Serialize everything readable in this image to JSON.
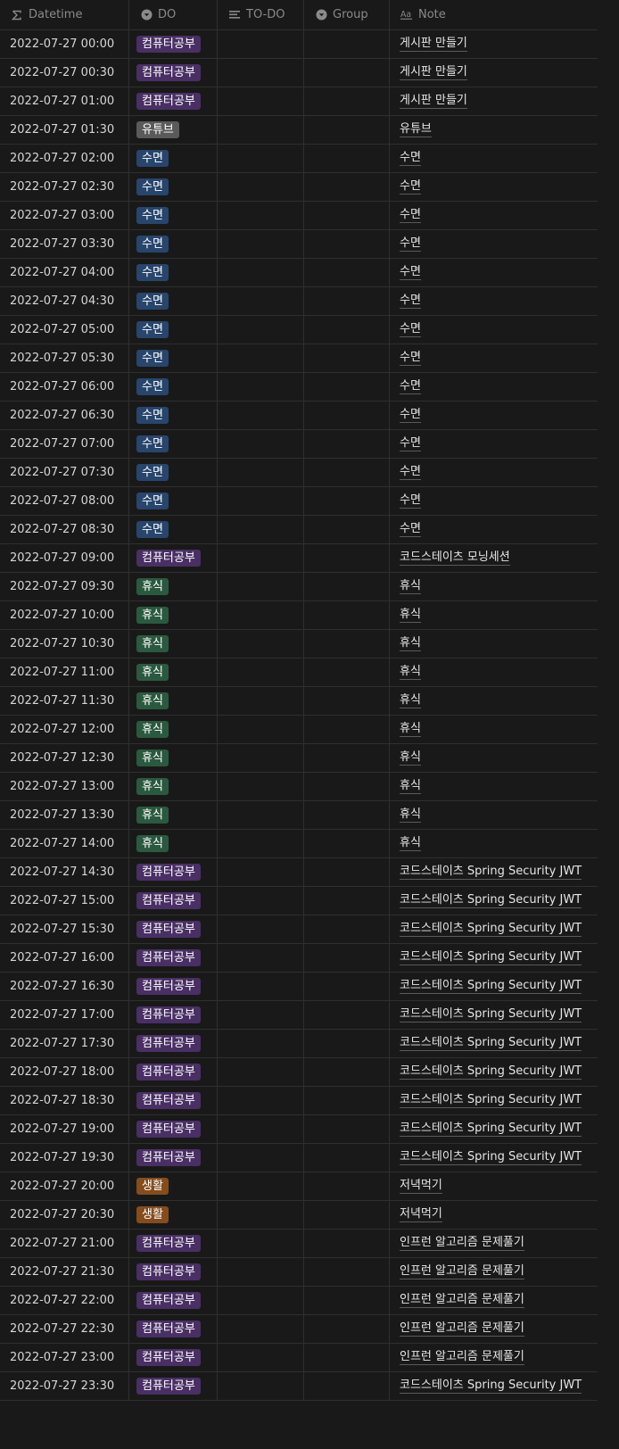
{
  "columns": [
    {
      "label": "Datetime",
      "icon": "formula-sigma-icon"
    },
    {
      "label": "DO",
      "icon": "select-chevron-icon"
    },
    {
      "label": "TO-DO",
      "icon": "text-lines-icon"
    },
    {
      "label": "Group",
      "icon": "select-chevron-icon"
    },
    {
      "label": "Note",
      "icon": "title-aa-icon"
    }
  ],
  "tag_colors": {
    "컴퓨터공부": "#492f64",
    "유튜브": "#5a5a5a",
    "수면": "#28456c",
    "휴식": "#2b593f",
    "생활": "#854c1d"
  },
  "rows": [
    {
      "datetime": "2022-07-27 00:00",
      "do": "컴퓨터공부",
      "todo": "",
      "group": "",
      "note": "게시판 만들기"
    },
    {
      "datetime": "2022-07-27 00:30",
      "do": "컴퓨터공부",
      "todo": "",
      "group": "",
      "note": "게시판 만들기"
    },
    {
      "datetime": "2022-07-27 01:00",
      "do": "컴퓨터공부",
      "todo": "",
      "group": "",
      "note": "게시판 만들기"
    },
    {
      "datetime": "2022-07-27 01:30",
      "do": "유튜브",
      "todo": "",
      "group": "",
      "note": "유튜브"
    },
    {
      "datetime": "2022-07-27 02:00",
      "do": "수면",
      "todo": "",
      "group": "",
      "note": "수면"
    },
    {
      "datetime": "2022-07-27 02:30",
      "do": "수면",
      "todo": "",
      "group": "",
      "note": "수면"
    },
    {
      "datetime": "2022-07-27 03:00",
      "do": "수면",
      "todo": "",
      "group": "",
      "note": "수면"
    },
    {
      "datetime": "2022-07-27 03:30",
      "do": "수면",
      "todo": "",
      "group": "",
      "note": "수면"
    },
    {
      "datetime": "2022-07-27 04:00",
      "do": "수면",
      "todo": "",
      "group": "",
      "note": "수면"
    },
    {
      "datetime": "2022-07-27 04:30",
      "do": "수면",
      "todo": "",
      "group": "",
      "note": "수면"
    },
    {
      "datetime": "2022-07-27 05:00",
      "do": "수면",
      "todo": "",
      "group": "",
      "note": "수면"
    },
    {
      "datetime": "2022-07-27 05:30",
      "do": "수면",
      "todo": "",
      "group": "",
      "note": "수면"
    },
    {
      "datetime": "2022-07-27 06:00",
      "do": "수면",
      "todo": "",
      "group": "",
      "note": "수면"
    },
    {
      "datetime": "2022-07-27 06:30",
      "do": "수면",
      "todo": "",
      "group": "",
      "note": "수면"
    },
    {
      "datetime": "2022-07-27 07:00",
      "do": "수면",
      "todo": "",
      "group": "",
      "note": "수면"
    },
    {
      "datetime": "2022-07-27 07:30",
      "do": "수면",
      "todo": "",
      "group": "",
      "note": "수면"
    },
    {
      "datetime": "2022-07-27 08:00",
      "do": "수면",
      "todo": "",
      "group": "",
      "note": "수면"
    },
    {
      "datetime": "2022-07-27 08:30",
      "do": "수면",
      "todo": "",
      "group": "",
      "note": "수면"
    },
    {
      "datetime": "2022-07-27 09:00",
      "do": "컴퓨터공부",
      "todo": "",
      "group": "",
      "note": "코드스테이츠 모닝세션"
    },
    {
      "datetime": "2022-07-27 09:30",
      "do": "휴식",
      "todo": "",
      "group": "",
      "note": "휴식"
    },
    {
      "datetime": "2022-07-27 10:00",
      "do": "휴식",
      "todo": "",
      "group": "",
      "note": "휴식"
    },
    {
      "datetime": "2022-07-27 10:30",
      "do": "휴식",
      "todo": "",
      "group": "",
      "note": "휴식"
    },
    {
      "datetime": "2022-07-27 11:00",
      "do": "휴식",
      "todo": "",
      "group": "",
      "note": "휴식"
    },
    {
      "datetime": "2022-07-27 11:30",
      "do": "휴식",
      "todo": "",
      "group": "",
      "note": "휴식"
    },
    {
      "datetime": "2022-07-27 12:00",
      "do": "휴식",
      "todo": "",
      "group": "",
      "note": "휴식"
    },
    {
      "datetime": "2022-07-27 12:30",
      "do": "휴식",
      "todo": "",
      "group": "",
      "note": "휴식"
    },
    {
      "datetime": "2022-07-27 13:00",
      "do": "휴식",
      "todo": "",
      "group": "",
      "note": "휴식"
    },
    {
      "datetime": "2022-07-27 13:30",
      "do": "휴식",
      "todo": "",
      "group": "",
      "note": "휴식"
    },
    {
      "datetime": "2022-07-27 14:00",
      "do": "휴식",
      "todo": "",
      "group": "",
      "note": "휴식"
    },
    {
      "datetime": "2022-07-27 14:30",
      "do": "컴퓨터공부",
      "todo": "",
      "group": "",
      "note": "코드스테이츠 Spring Security JWT"
    },
    {
      "datetime": "2022-07-27 15:00",
      "do": "컴퓨터공부",
      "todo": "",
      "group": "",
      "note": "코드스테이츠 Spring Security JWT"
    },
    {
      "datetime": "2022-07-27 15:30",
      "do": "컴퓨터공부",
      "todo": "",
      "group": "",
      "note": "코드스테이츠 Spring Security JWT"
    },
    {
      "datetime": "2022-07-27 16:00",
      "do": "컴퓨터공부",
      "todo": "",
      "group": "",
      "note": "코드스테이츠 Spring Security JWT"
    },
    {
      "datetime": "2022-07-27 16:30",
      "do": "컴퓨터공부",
      "todo": "",
      "group": "",
      "note": "코드스테이츠 Spring Security JWT"
    },
    {
      "datetime": "2022-07-27 17:00",
      "do": "컴퓨터공부",
      "todo": "",
      "group": "",
      "note": "코드스테이츠 Spring Security JWT"
    },
    {
      "datetime": "2022-07-27 17:30",
      "do": "컴퓨터공부",
      "todo": "",
      "group": "",
      "note": "코드스테이츠 Spring Security JWT"
    },
    {
      "datetime": "2022-07-27 18:00",
      "do": "컴퓨터공부",
      "todo": "",
      "group": "",
      "note": "코드스테이츠 Spring Security JWT"
    },
    {
      "datetime": "2022-07-27 18:30",
      "do": "컴퓨터공부",
      "todo": "",
      "group": "",
      "note": "코드스테이츠 Spring Security JWT"
    },
    {
      "datetime": "2022-07-27 19:00",
      "do": "컴퓨터공부",
      "todo": "",
      "group": "",
      "note": "코드스테이츠 Spring Security JWT"
    },
    {
      "datetime": "2022-07-27 19:30",
      "do": "컴퓨터공부",
      "todo": "",
      "group": "",
      "note": "코드스테이츠 Spring Security JWT"
    },
    {
      "datetime": "2022-07-27 20:00",
      "do": "생활",
      "todo": "",
      "group": "",
      "note": "저녁먹기"
    },
    {
      "datetime": "2022-07-27 20:30",
      "do": "생활",
      "todo": "",
      "group": "",
      "note": "저녁먹기"
    },
    {
      "datetime": "2022-07-27 21:00",
      "do": "컴퓨터공부",
      "todo": "",
      "group": "",
      "note": "인프런 알고리즘 문제풀기"
    },
    {
      "datetime": "2022-07-27 21:30",
      "do": "컴퓨터공부",
      "todo": "",
      "group": "",
      "note": "인프런 알고리즘 문제풀기"
    },
    {
      "datetime": "2022-07-27 22:00",
      "do": "컴퓨터공부",
      "todo": "",
      "group": "",
      "note": "인프런 알고리즘 문제풀기"
    },
    {
      "datetime": "2022-07-27 22:30",
      "do": "컴퓨터공부",
      "todo": "",
      "group": "",
      "note": "인프런 알고리즘 문제풀기"
    },
    {
      "datetime": "2022-07-27 23:00",
      "do": "컴퓨터공부",
      "todo": "",
      "group": "",
      "note": "인프런 알고리즘 문제풀기"
    },
    {
      "datetime": "2022-07-27 23:30",
      "do": "컴퓨터공부",
      "todo": "",
      "group": "",
      "note": "코드스테이츠 Spring Security JWT"
    }
  ]
}
